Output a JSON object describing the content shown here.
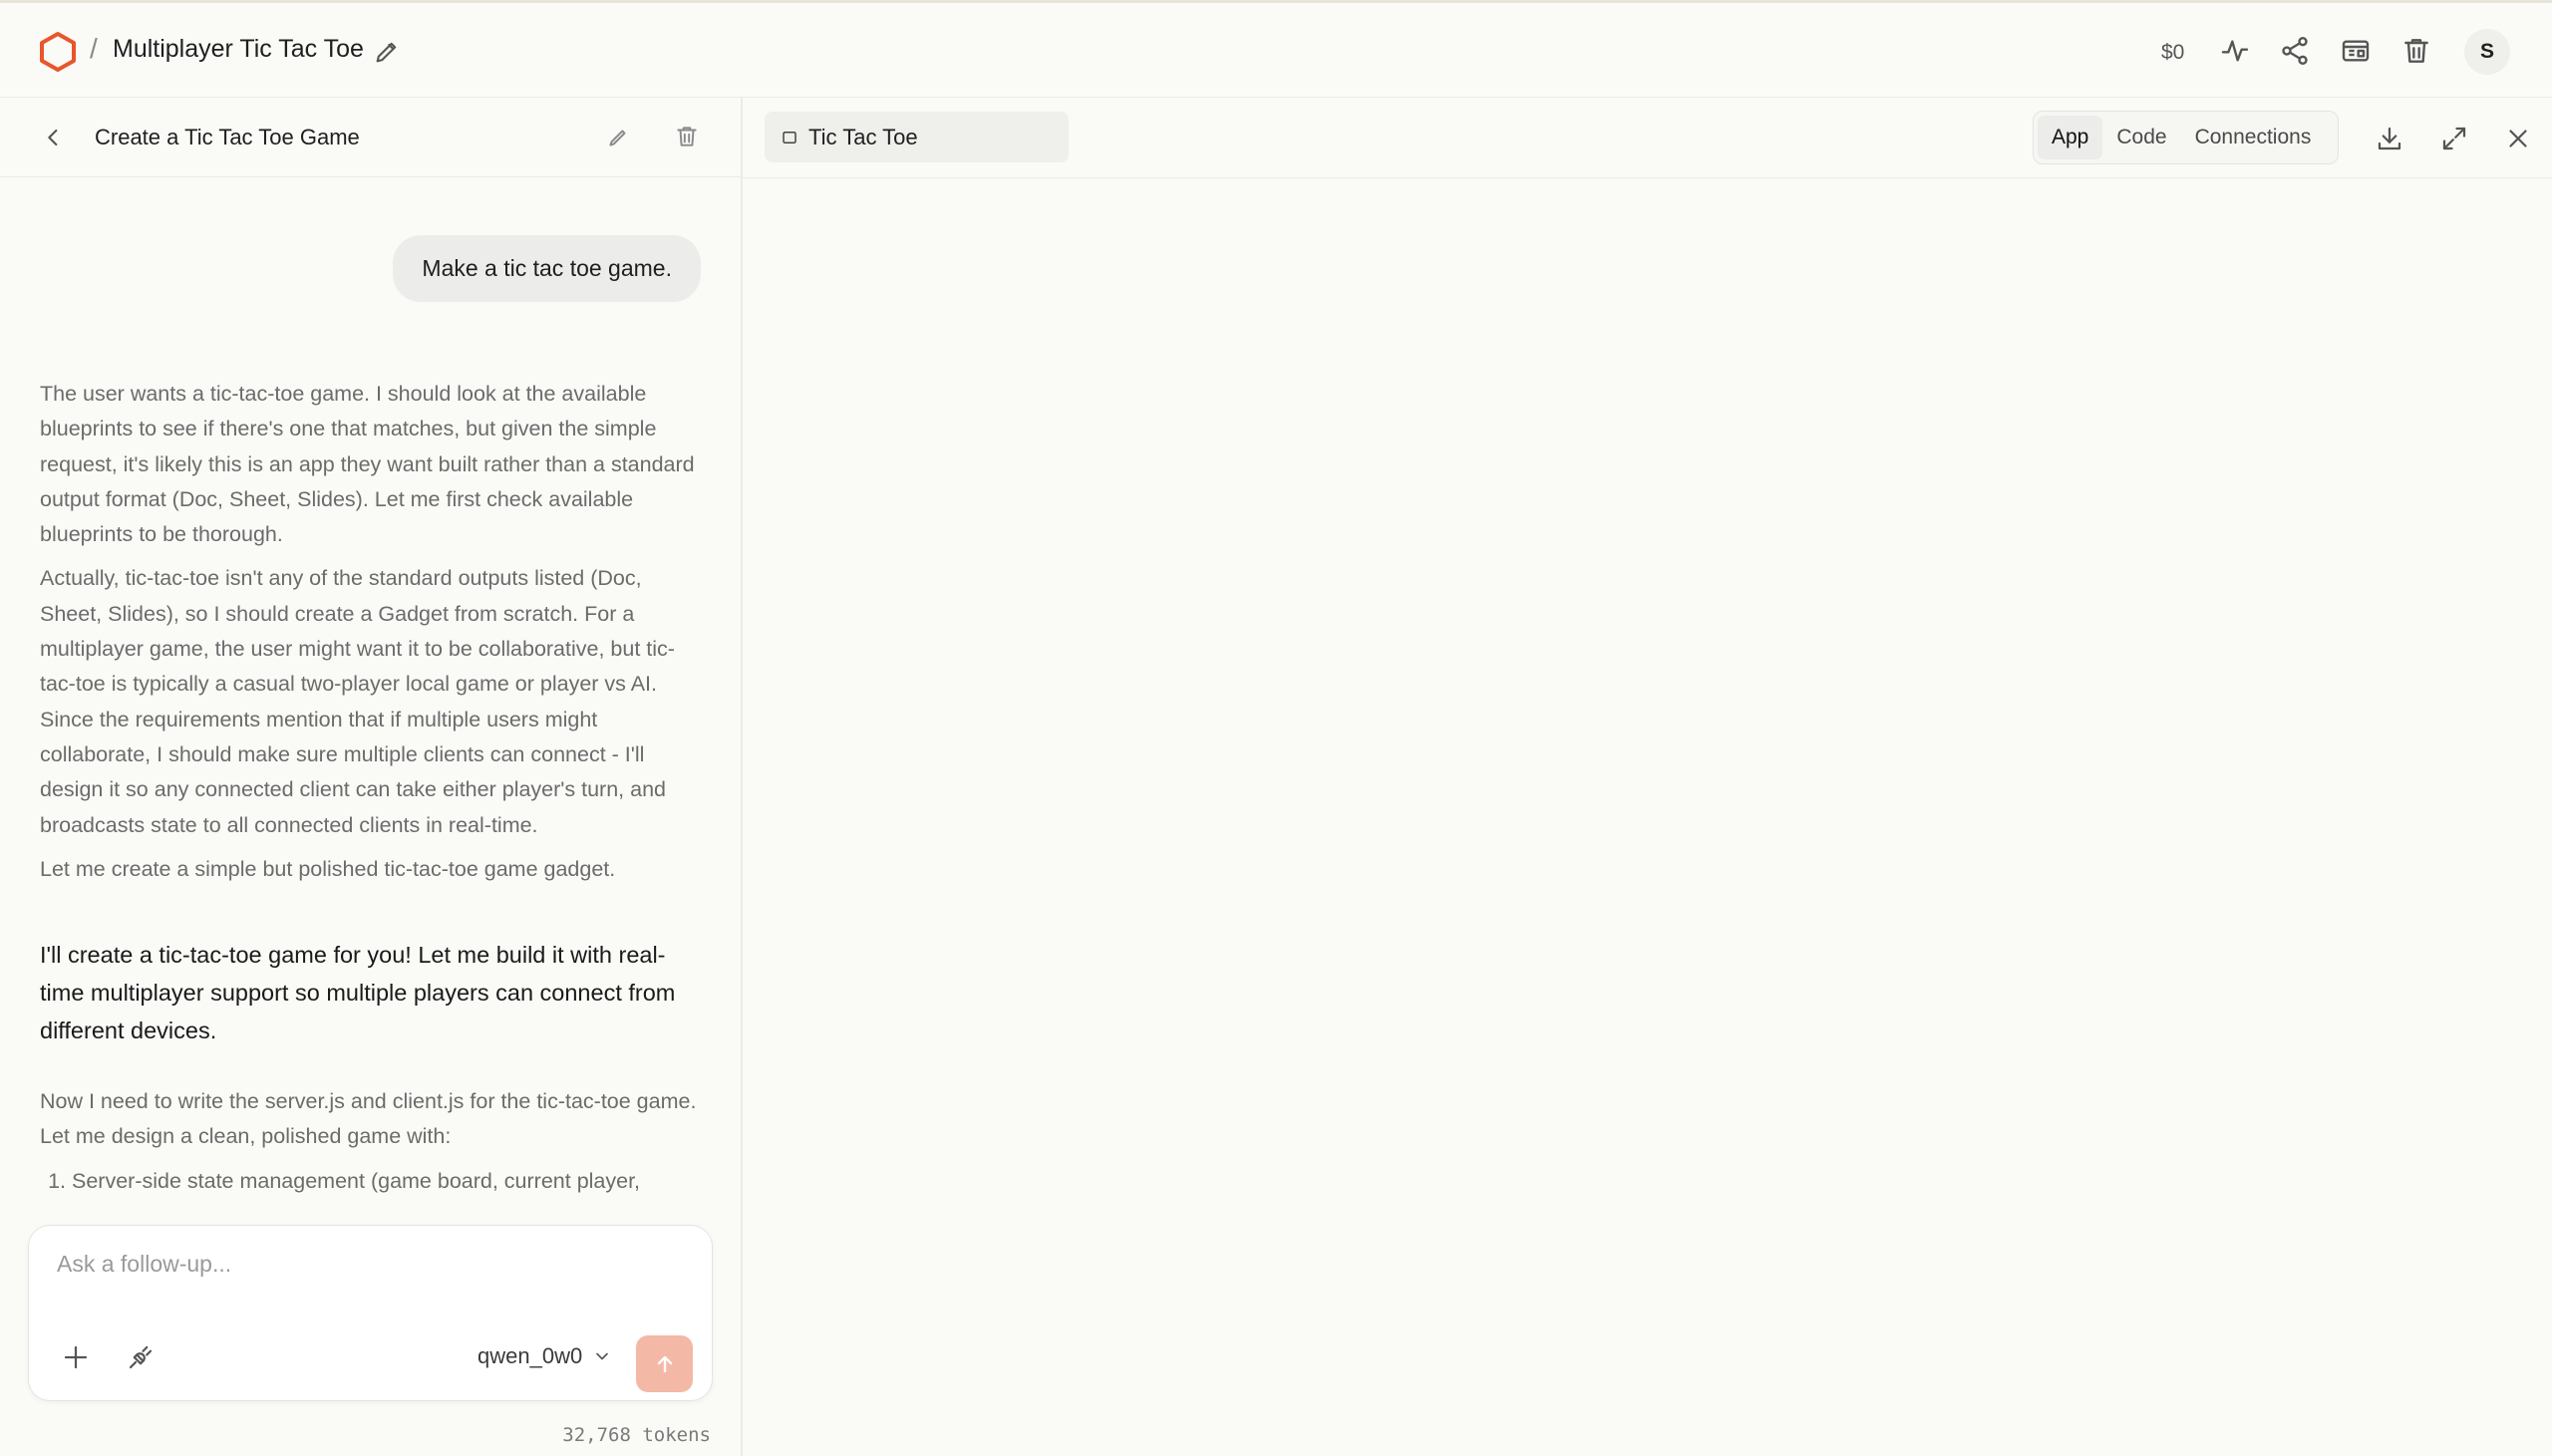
{
  "topbar": {
    "separator": "/",
    "title": "Multiplayer Tic Tac Toe",
    "cost": "$0",
    "avatar_initial": "S",
    "brand_color": "#e8562a"
  },
  "chat": {
    "title": "Create a Tic Tac Toe Game",
    "user_message": "Make a tic tac toe game.",
    "thinking": [
      "The user wants a tic-tac-toe game. I should look at the available blueprints to see if there's one that matches, but given the simple request, it's likely this is an app they want built rather than a standard output format (Doc, Sheet, Slides). Let me first check available blueprints to be thorough.",
      "Actually, tic-tac-toe isn't any of the standard outputs listed (Doc, Sheet, Slides), so I should create a Gadget from scratch. For a multiplayer game, the user might want it to be collaborative, but tic-tac-toe is typically a casual two-player local game or player vs AI. Since the requirements mention that if multiple users might collaborate, I should make sure multiple clients can connect - I'll design it so any connected client can take either player's turn, and broadcasts state to all connected clients in real-time.",
      "Let me create a simple but polished tic-tac-toe game gadget."
    ],
    "answer": "I'll create a tic-tac-toe game for you! Let me build it with real-time multiplayer support so multiple players can connect from different devices.",
    "thinking2": "Now I need to write the server.js and client.js for the tic-tac-toe game. Let me design a clean, polished game with:",
    "thinking2_list": [
      "Server-side state management (game board, current player,"
    ],
    "composer_placeholder": "Ask a follow-up...",
    "model": "qwen_0w0",
    "tokens": "32,768 tokens",
    "send_color": "#f4b8a6"
  },
  "preview": {
    "file_tab": "Tic Tac Toe",
    "tabs": [
      "App",
      "Code",
      "Connections"
    ],
    "active_tab": "App"
  }
}
